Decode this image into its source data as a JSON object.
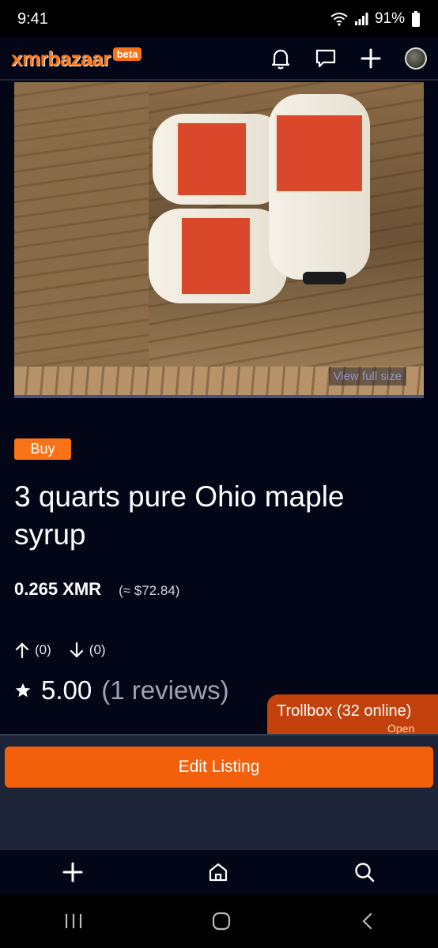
{
  "status_bar": {
    "time": "9:41",
    "battery": "91%"
  },
  "header": {
    "logo_text": "xmrbazaar",
    "logo_badge": "beta",
    "icons": [
      "bell-icon",
      "message-icon",
      "plus-icon",
      "avatar"
    ]
  },
  "listing": {
    "image_link": "View full size",
    "badge": "Buy",
    "title": "3 quarts pure Ohio maple syrup",
    "price_xmr": "0.265 XMR",
    "price_usd": "(≈ $72.84)",
    "upvotes": "(0)",
    "downvotes": "(0)",
    "rating": "5.00",
    "review_count": "(1 reviews)"
  },
  "trollbox": {
    "title": "Trollbox (32 online)",
    "subtitle": "Open"
  },
  "actions": {
    "edit_label": "Edit Listing"
  },
  "bottom_nav": [
    "plus-icon",
    "home-icon",
    "search-icon"
  ],
  "android_nav": [
    "recents-icon",
    "home-button-icon",
    "back-icon"
  ],
  "colors": {
    "accent": "#f97316",
    "background": "#020617",
    "panel": "#1e2438",
    "button": "#f2600c"
  }
}
